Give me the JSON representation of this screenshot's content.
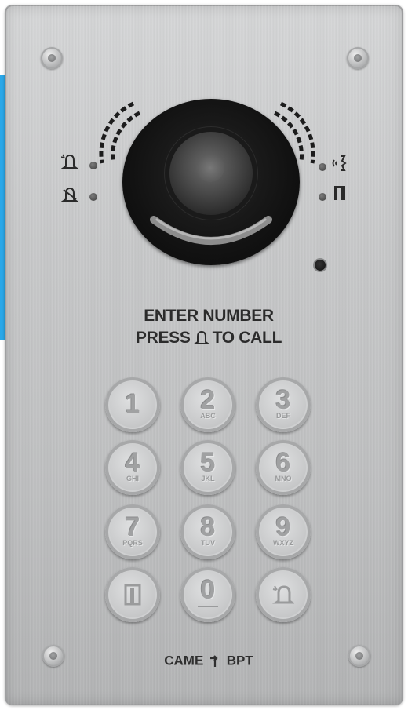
{
  "panel": {
    "instructions": {
      "line1": "ENTER NUMBER",
      "line2_prefix": "PRESS",
      "line2_icon": "bell-icon",
      "line2_suffix": "TO CALL"
    },
    "status_icons_left": [
      "call-bell-icon",
      "muted-bell-icon"
    ],
    "status_icons_right": [
      "speaking-icon",
      "door-open-icon"
    ],
    "keypad": [
      {
        "digit": "1",
        "letters": ""
      },
      {
        "digit": "2",
        "letters": "ABC"
      },
      {
        "digit": "3",
        "letters": "DEF"
      },
      {
        "digit": "4",
        "letters": "GHI"
      },
      {
        "digit": "5",
        "letters": "JKL"
      },
      {
        "digit": "6",
        "letters": "MNO"
      },
      {
        "digit": "7",
        "letters": "PQRS"
      },
      {
        "digit": "8",
        "letters": "TUV"
      },
      {
        "digit": "9",
        "letters": "WXYZ"
      },
      {
        "digit": "",
        "letters": "",
        "icon": "door-icon"
      },
      {
        "digit": "0",
        "letters": ""
      },
      {
        "digit": "",
        "letters": "",
        "icon": "call-bell-icon"
      }
    ],
    "brand": {
      "left": "CAME",
      "logo_icon": "arrow-logo-icon",
      "right": "BPT"
    }
  },
  "colors": {
    "accent_strip": "#2aa7e8",
    "panel_metal": "#c7c8c9",
    "camera": "#111111",
    "text": "#2b2b2b"
  }
}
